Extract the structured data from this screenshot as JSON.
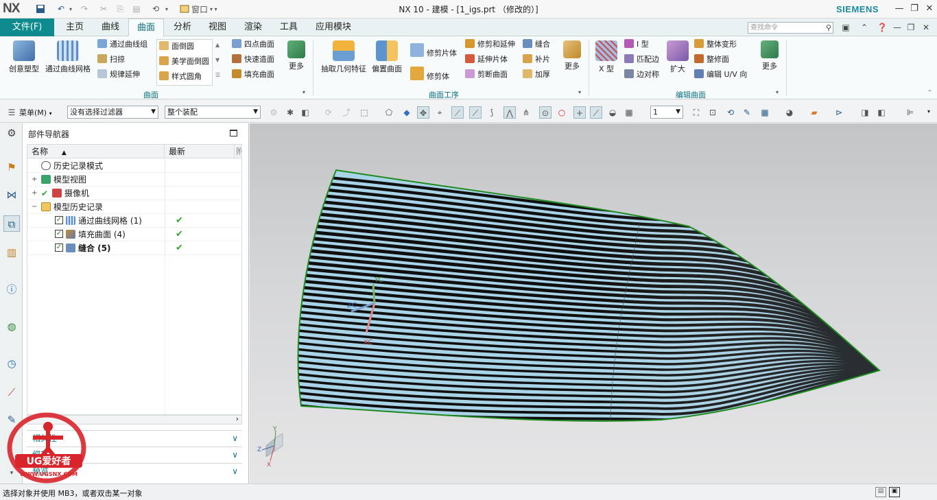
{
  "title_bar": {
    "logo": "NX",
    "window_menu": "窗口",
    "window_title": "NX 10 - 建模 - [1_igs.prt （修改的）]",
    "brand": "SIEMENS",
    "minimize": "—",
    "restore": "❐",
    "close": "✕"
  },
  "tabs": {
    "file": "文件(F)",
    "items": [
      "主页",
      "曲线",
      "曲面",
      "分析",
      "视图",
      "渲染",
      "工具",
      "应用模块"
    ],
    "active": "曲面"
  },
  "search": {
    "placeholder": "查找命令"
  },
  "ribbon": {
    "surface_group": {
      "label": "曲面",
      "creative": "创意塑型",
      "through_curve_mesh": "通过曲线网格",
      "through_curves": "通过曲线组",
      "sweep": "扫掠",
      "ruled_extension": "规律延伸",
      "face_blend": "面倒圆",
      "aesthetic_face_blend": "美学面倒圆",
      "styled_corner": "样式圆角",
      "four_point": "四点曲面",
      "rapid_surfacing": "快速造面",
      "fill_surface": "填充曲面",
      "more": "更多"
    },
    "surface_ops_group": {
      "label": "曲面工序",
      "extract_geometry": "抽取几何特征",
      "offset_surface": "偏置曲面",
      "trim_sheet": "修剪片体",
      "trim_body": "修剪体",
      "trim_extend": "修剪和延伸",
      "extend_sheet": "延伸片体",
      "trimmed_surface": "剪断曲面",
      "sew": "缝合",
      "patch": "补片",
      "thicken": "加厚",
      "more": "更多"
    },
    "edit_surface_group": {
      "label": "编辑曲面",
      "x_form": "X 型",
      "i_form": "I 型",
      "match_edge": "匹配边",
      "edge_symmetry": "边对称",
      "enlarge": "扩大",
      "global_shaping": "整体变形",
      "refit_face": "整修面",
      "edit_uv": "编辑 U/V 向",
      "more": "更多"
    }
  },
  "selection_bar": {
    "menu": "菜单(M)",
    "filter": "没有选择过滤器",
    "scope": "整个装配",
    "layer": "1"
  },
  "navigator": {
    "title": "部件导航器",
    "col_name": "名称",
    "col_latest": "最新",
    "col_extra": "附",
    "rows": [
      {
        "label": "历史记录模式",
        "latest": ""
      },
      {
        "label": "模型视图",
        "latest": ""
      },
      {
        "label": "摄像机",
        "latest": ""
      },
      {
        "label": "模型历史记录",
        "latest": ""
      },
      {
        "label": "通过曲线网格 (1)",
        "latest": "✔"
      },
      {
        "label": "填充曲面 (4)",
        "latest": "✔"
      },
      {
        "label": "缝合 (5)",
        "latest": "✔"
      }
    ],
    "panels": [
      "相关性",
      "细节",
      "预览"
    ]
  },
  "viewport": {
    "triad_labels": {
      "yc": "YC",
      "zc": "ZC",
      "xc": "XC",
      "y": "Y",
      "z": "Z",
      "x": "X"
    },
    "stripe_count": 38,
    "colors": {
      "surface": "#a9d3e6",
      "stripe": "#0f0f0f",
      "edge": "#1e8a1e"
    }
  },
  "status": {
    "message": "选择对象并使用 MB3，或者双击某一对象"
  },
  "watermark": {
    "text": "UG爱好者",
    "url": "WWW.UGSNX.COM"
  }
}
